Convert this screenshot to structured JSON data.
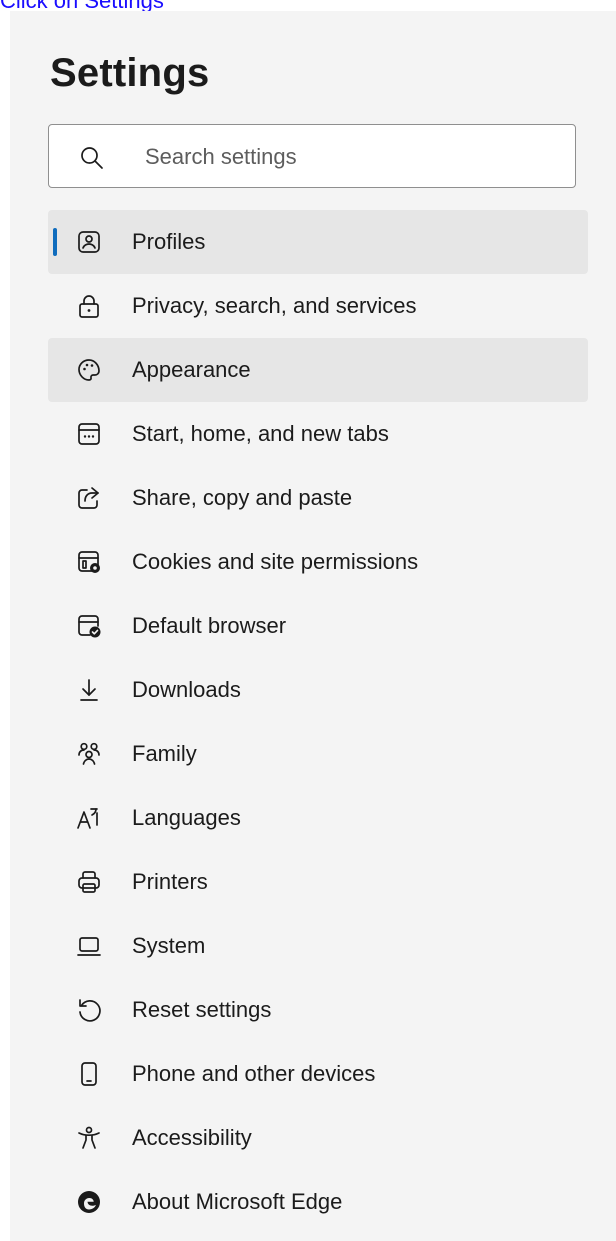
{
  "caption": "Click on Settings",
  "page_title": "Settings",
  "search": {
    "placeholder": "Search settings",
    "icon": "search-icon"
  },
  "colors": {
    "accent": "#0f6cbd",
    "selected_bg": "#e6e6e6",
    "panel_bg": "#f4f4f4",
    "caption": "#1a0dff"
  },
  "nav": {
    "selected": "Profiles",
    "hovered": "Appearance",
    "items": [
      {
        "label": "Profiles",
        "icon": "profile-icon"
      },
      {
        "label": "Privacy, search, and services",
        "icon": "lock-icon"
      },
      {
        "label": "Appearance",
        "icon": "palette-icon"
      },
      {
        "label": "Start, home, and new tabs",
        "icon": "home-tab-icon"
      },
      {
        "label": "Share, copy and paste",
        "icon": "share-icon"
      },
      {
        "label": "Cookies and site permissions",
        "icon": "cookies-icon"
      },
      {
        "label": "Default browser",
        "icon": "default-browser-icon"
      },
      {
        "label": "Downloads",
        "icon": "download-icon"
      },
      {
        "label": "Family",
        "icon": "family-icon"
      },
      {
        "label": "Languages",
        "icon": "languages-icon"
      },
      {
        "label": "Printers",
        "icon": "printer-icon"
      },
      {
        "label": "System",
        "icon": "laptop-icon"
      },
      {
        "label": "Reset settings",
        "icon": "reset-icon"
      },
      {
        "label": "Phone and other devices",
        "icon": "phone-icon"
      },
      {
        "label": "Accessibility",
        "icon": "accessibility-icon"
      },
      {
        "label": "About Microsoft Edge",
        "icon": "edge-logo-icon"
      }
    ]
  }
}
